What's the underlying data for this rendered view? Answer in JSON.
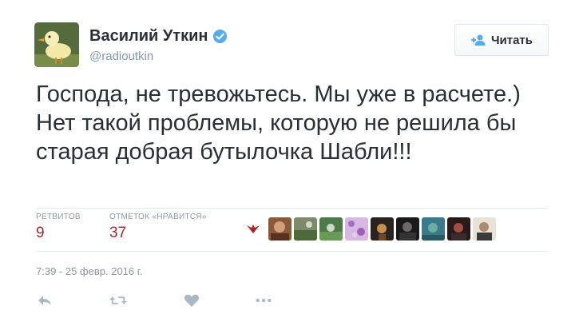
{
  "author": {
    "name": "Василий Уткин",
    "handle": "@radioutkin",
    "avatar_icon": "duck-avatar",
    "verified_icon": "verified-badge-icon"
  },
  "follow_button": {
    "label": "Читать",
    "icon": "add-user-icon"
  },
  "tweet": {
    "text": "Господа, не тревожьтесь. Мы уже в расчете.) Нет такой проблемы, которую не решила бы старая добрая бутылочка Шабли!!!"
  },
  "stats": {
    "retweets_label": "РЕТВИТОВ",
    "retweets_value": "9",
    "likes_label": "ОТМЕТОК «НРАВИТСЯ»",
    "likes_value": "37"
  },
  "likers": {
    "logo_icon": "red-bird-logo",
    "avatars": [
      "liker-1",
      "liker-2",
      "liker-3",
      "liker-4",
      "liker-5",
      "liker-6",
      "liker-7",
      "liker-8",
      "liker-9"
    ]
  },
  "timestamp": "7:39 - 25 февр. 2016 г.",
  "actions": [
    "reply-icon",
    "retweet-icon",
    "like-icon",
    "more-icon"
  ],
  "colors": {
    "stat_value": "#a52a2a",
    "muted": "#8899a6",
    "verified": "#55acee",
    "border": "#e1e8ed"
  }
}
